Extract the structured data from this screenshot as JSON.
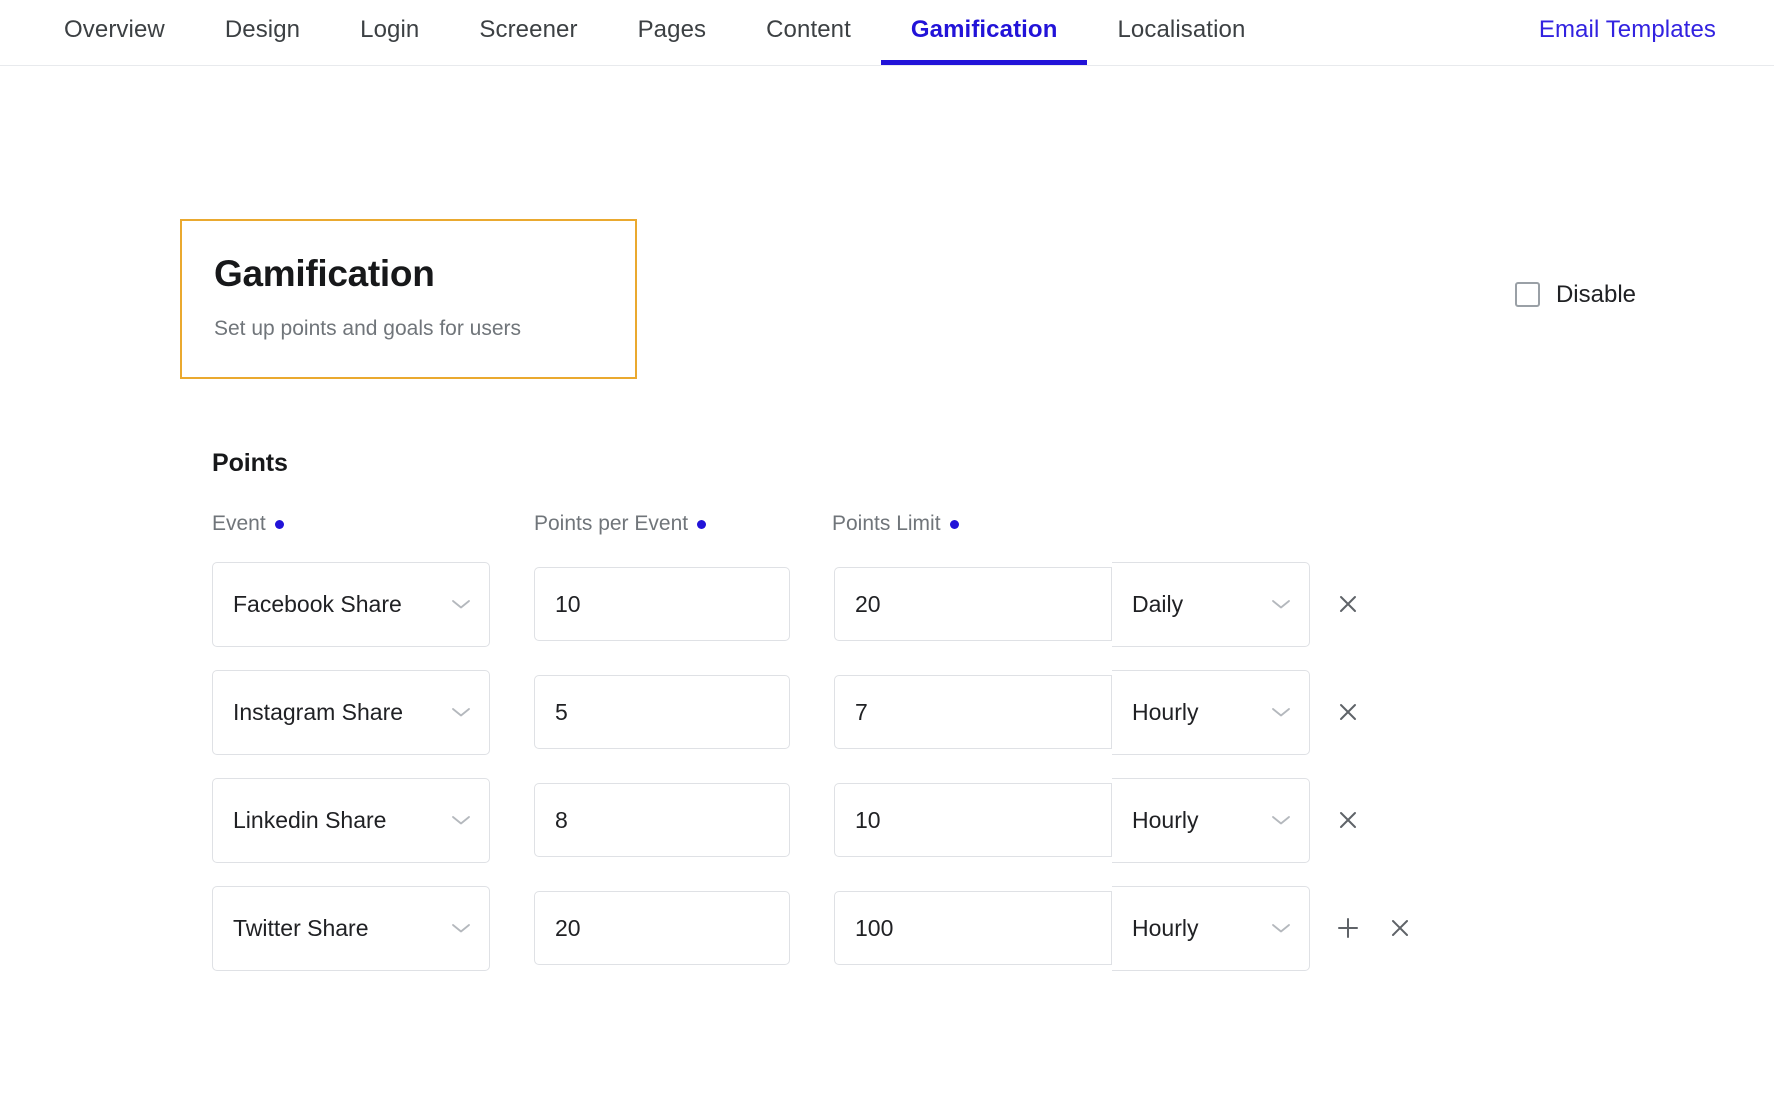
{
  "nav": {
    "tabs": [
      {
        "label": "Overview",
        "state": "default"
      },
      {
        "label": "Design",
        "state": "default"
      },
      {
        "label": "Login",
        "state": "default"
      },
      {
        "label": "Screener",
        "state": "default"
      },
      {
        "label": "Pages",
        "state": "default"
      },
      {
        "label": "Content",
        "state": "default"
      },
      {
        "label": "Gamification",
        "state": "active"
      },
      {
        "label": "Localisation",
        "state": "default"
      },
      {
        "label": "Email Templates",
        "state": "link"
      }
    ]
  },
  "header": {
    "title": "Gamification",
    "subtitle": "Set up points and goals for users",
    "highlight_color": "#eaa92f",
    "disable": {
      "label": "Disable",
      "checked": false
    }
  },
  "points_section": {
    "heading": "Points",
    "columns": [
      {
        "label": "Event",
        "has_info_dot": true
      },
      {
        "label": "Points per Event",
        "has_info_dot": true
      },
      {
        "label": "Points Limit",
        "has_info_dot": true
      }
    ],
    "info_dot_color": "#2213d8",
    "rows": [
      {
        "event": "Facebook Share",
        "points_per_event": "10",
        "points_limit": "20",
        "period": "Daily",
        "actions": [
          "remove"
        ]
      },
      {
        "event": "Instagram Share",
        "points_per_event": "5",
        "points_limit": "7",
        "period": "Hourly",
        "actions": [
          "remove"
        ]
      },
      {
        "event": "Linkedin Share",
        "points_per_event": "8",
        "points_limit": "10",
        "period": "Hourly",
        "actions": [
          "remove"
        ]
      },
      {
        "event": "Twitter Share",
        "points_per_event": "20",
        "points_limit": "100",
        "period": "Hourly",
        "actions": [
          "add",
          "remove"
        ]
      }
    ]
  },
  "icons": {
    "chevron_down": "chevron-down-icon",
    "add": "plus-icon",
    "remove": "close-icon",
    "checkbox": "checkbox-icon"
  },
  "colors": {
    "accent_blue": "#2213d8",
    "highlight_orange": "#eaa92f",
    "text_primary": "#202124",
    "text_muted": "#70757a",
    "border": "#dfe1e5"
  }
}
